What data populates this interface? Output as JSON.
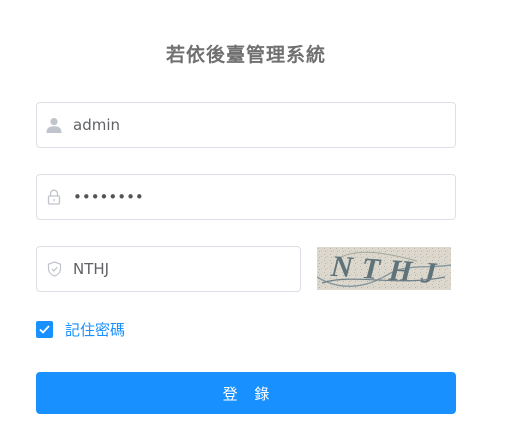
{
  "app": {
    "title": "若依後臺管理系統"
  },
  "form": {
    "username": {
      "value": "admin",
      "icon": "user-icon"
    },
    "password": {
      "masked_value": "••••••••",
      "icon": "lock-icon"
    },
    "code": {
      "value": "NTHJ",
      "icon": "shield-icon"
    },
    "captcha": {
      "text": "NTHJ"
    },
    "remember": {
      "label": "記住密碼",
      "checked": true
    },
    "submit_label": "登 錄"
  },
  "colors": {
    "accent": "#1890ff",
    "title": "#707070",
    "input_border": "#dcdfe6",
    "icon": "#c0c4cc"
  }
}
